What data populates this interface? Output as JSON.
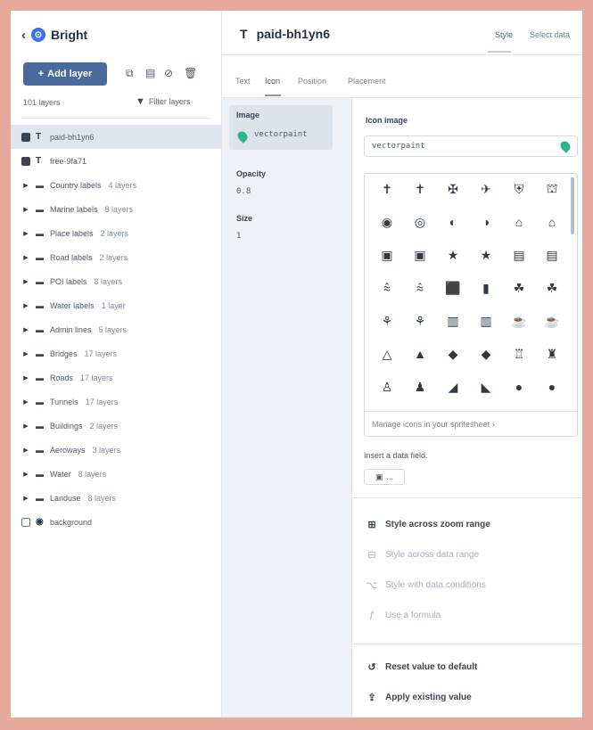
{
  "left": {
    "back_icon": "chevron-left-icon",
    "app_name": "Bright",
    "add_layer_label": "Add layer",
    "layer_count": "101 layers",
    "filter_label": "Filter layers",
    "layers": [
      {
        "type": "T",
        "name": "paid-bh1yn6",
        "sub": "",
        "selected": true,
        "kind": "text"
      },
      {
        "type": "T",
        "name": "free-9fa71",
        "sub": "",
        "selected": false,
        "kind": "text"
      },
      {
        "name": "Country labels",
        "sub": "4 layers",
        "kind": "group"
      },
      {
        "name": "Marine labels",
        "sub": "8 layers",
        "kind": "group"
      },
      {
        "name": "Place labels",
        "sub": "2 layers",
        "kind": "group"
      },
      {
        "name": "Road labels",
        "sub": "2 layers",
        "kind": "group"
      },
      {
        "name": "POI labels",
        "sub": "8 layers",
        "kind": "group"
      },
      {
        "name": "Water labels",
        "sub": "1 layer",
        "kind": "group"
      },
      {
        "name": "Admin lines",
        "sub": "5 layers",
        "kind": "group"
      },
      {
        "name": "Bridges",
        "sub": "17 layers",
        "kind": "group"
      },
      {
        "name": "Roads",
        "sub": "17 layers",
        "kind": "group"
      },
      {
        "name": "Tunnels",
        "sub": "17 layers",
        "kind": "group"
      },
      {
        "name": "Buildings",
        "sub": "2 layers",
        "kind": "group"
      },
      {
        "name": "Aeroways",
        "sub": "3 layers",
        "kind": "group"
      },
      {
        "name": "Water",
        "sub": "8 layers",
        "kind": "group"
      },
      {
        "name": "Landuse",
        "sub": "8 layers",
        "kind": "group"
      },
      {
        "name": "background",
        "sub": "",
        "kind": "background"
      }
    ]
  },
  "header": {
    "title_type": "T",
    "title": "paid-bh1yn6",
    "tab_style": "Style",
    "tab_select_data": "Select data"
  },
  "subtabs": {
    "text": "Text",
    "icon": "Icon",
    "position": "Position",
    "placement": "Placement"
  },
  "props": {
    "image_label": "Image",
    "image_value": "vectorpaint",
    "opacity_label": "Opacity",
    "opacity_value": "0.8",
    "size_label": "Size",
    "size_value": "1"
  },
  "editor": {
    "icon_image_label": "Icon image",
    "icon_image_value": "vectorpaint",
    "icons": [
      [
        "✝",
        "✝",
        "✠",
        "✈",
        "⛨",
        "⛫"
      ],
      [
        "◉",
        "◎",
        "◐",
        "◑",
        "⌂",
        "⌂"
      ],
      [
        "▣",
        "▣",
        "★",
        "★",
        "▤",
        "▤"
      ],
      [
        "⩯",
        "⩯",
        "⬛",
        "▮",
        "☘",
        "☘"
      ],
      [
        "⚘",
        "⚘",
        "▥",
        "▥",
        "☕",
        "☕"
      ],
      [
        "△",
        "▲",
        "◆",
        "◆",
        "♖",
        "♜"
      ],
      [
        "♙",
        "♟",
        "◢",
        "◣",
        "●",
        "●"
      ]
    ],
    "manage_icons": "Manage icons in your spritesheet",
    "insert_label": "Insert a data field.",
    "chip_text": "...",
    "actions": [
      {
        "icon": "zoom-range-icon",
        "glyph": "⊞",
        "label": "Style across zoom range",
        "strong": true
      },
      {
        "icon": "data-range-icon",
        "glyph": "⊟",
        "label": "Style across data range",
        "strong": false
      },
      {
        "icon": "data-conditions-icon",
        "glyph": "⌥",
        "label": "Style with data conditions",
        "strong": false
      },
      {
        "icon": "formula-icon",
        "glyph": "ƒ",
        "label": "Use a formula",
        "strong": false
      }
    ],
    "reset_label": "Reset value to default",
    "apply_label": "Apply existing value"
  },
  "colors": {
    "accent": "#4a6a9e",
    "pin": "#2bb58a",
    "border": "#e8a99d"
  }
}
